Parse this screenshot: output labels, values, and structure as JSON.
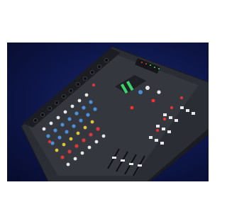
{
  "image": {
    "subject": "audio-mixer-console-photo",
    "colors": {
      "page_background": "#ffffff",
      "backdrop": "#0d1648",
      "chassis": "#2a2d33",
      "knob_blue": "#4a8fd8",
      "knob_red": "#d8383a",
      "knob_yellow": "#e0c23c",
      "knob_white": "#e8e8e8",
      "led_green": "#3cd46a",
      "led_red": "#ff3030"
    }
  }
}
